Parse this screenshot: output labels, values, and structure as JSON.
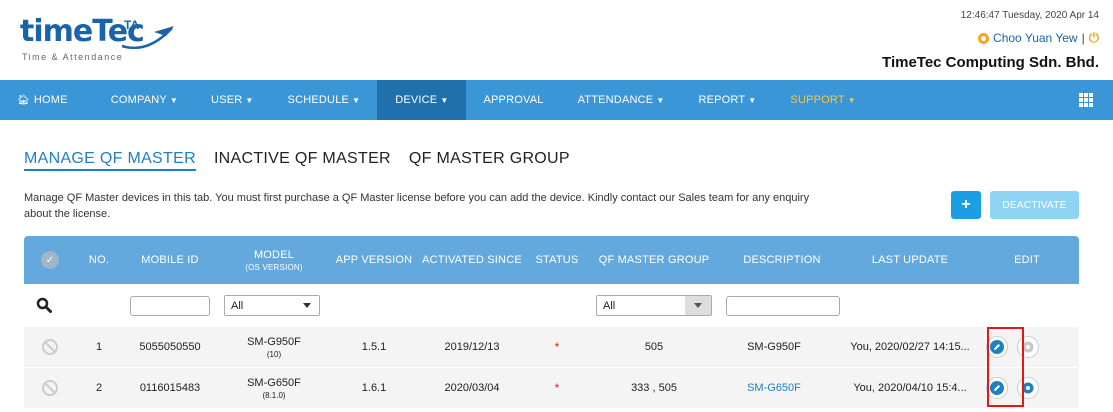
{
  "header": {
    "logo_main_1": "time",
    "logo_main_2": "Tec",
    "logo_ta": "TA",
    "logo_sub": "Time & Attendance",
    "datetime": "12:46:47 Tuesday, 2020 Apr 14",
    "user_name": "Choo Yuan Yew",
    "separator": "|",
    "company": "TimeTec Computing Sdn. Bhd.",
    "accent": "#1b63a7",
    "user_icon_color": "#f5a623"
  },
  "nav": {
    "items": [
      {
        "label": "HOME",
        "icon": "home-icon"
      },
      {
        "label": "COMPANY",
        "caret": "▼"
      },
      {
        "label": "USER",
        "caret": "▼"
      },
      {
        "label": "SCHEDULE",
        "caret": "▼"
      },
      {
        "label": "DEVICE",
        "caret": "▼"
      },
      {
        "label": "APPROVAL"
      },
      {
        "label": "ATTENDANCE",
        "caret": "▼"
      },
      {
        "label": "REPORT",
        "caret": "▼"
      },
      {
        "label": "SUPPORT",
        "caret": "▼"
      }
    ],
    "active": "DEVICE",
    "bg_color": "#3a96d6",
    "active_color": "#1f70ad",
    "support_color": "#f6c845"
  },
  "tabs": [
    {
      "label": "MANAGE QF MASTER",
      "active": true
    },
    {
      "label": "INACTIVE QF MASTER",
      "active": false
    },
    {
      "label": "QF MASTER GROUP",
      "active": false
    }
  ],
  "description": "Manage QF Master devices in this tab. You must first purchase a QF Master license before you can add the device. Kindly contact our Sales team for any enquiry about the license.",
  "actions": {
    "add_label": "+",
    "deactivate_label": "DEACTIVATE"
  },
  "table": {
    "columns": [
      {
        "label": "",
        "icon": "check-circle-icon"
      },
      {
        "label": "NO."
      },
      {
        "label": "MOBILE ID"
      },
      {
        "label": "MODEL",
        "sub": "(OS VERSION)"
      },
      {
        "label": "APP VERSION"
      },
      {
        "label": "ACTIVATED SINCE"
      },
      {
        "label": "STATUS"
      },
      {
        "label": "QF MASTER GROUP"
      },
      {
        "label": "DESCRIPTION"
      },
      {
        "label": "LAST UPDATE"
      },
      {
        "label": "EDIT"
      }
    ],
    "filters": {
      "model_select": "All",
      "group_select": "All"
    },
    "rows": [
      {
        "no": "1",
        "mobile_id": "5055050550",
        "model": "SM-G950F",
        "os": "(10)",
        "app_version": "1.5.1",
        "activated": "2019/12/13",
        "status": "*",
        "group": "505",
        "description": "SM-G950F",
        "last_update": "You, 2020/02/27 14:15..."
      },
      {
        "no": "2",
        "mobile_id": "0116015483",
        "model": "SM-G650F",
        "os": "(8.1.0)",
        "app_version": "1.6.1",
        "activated": "2020/03/04",
        "status": "*",
        "group": "333 , 505",
        "description": "SM-G650F",
        "last_update": "You, 2020/04/10 15:4..."
      }
    ],
    "header_color": "#64a9dd",
    "status_color": "#e02020"
  }
}
